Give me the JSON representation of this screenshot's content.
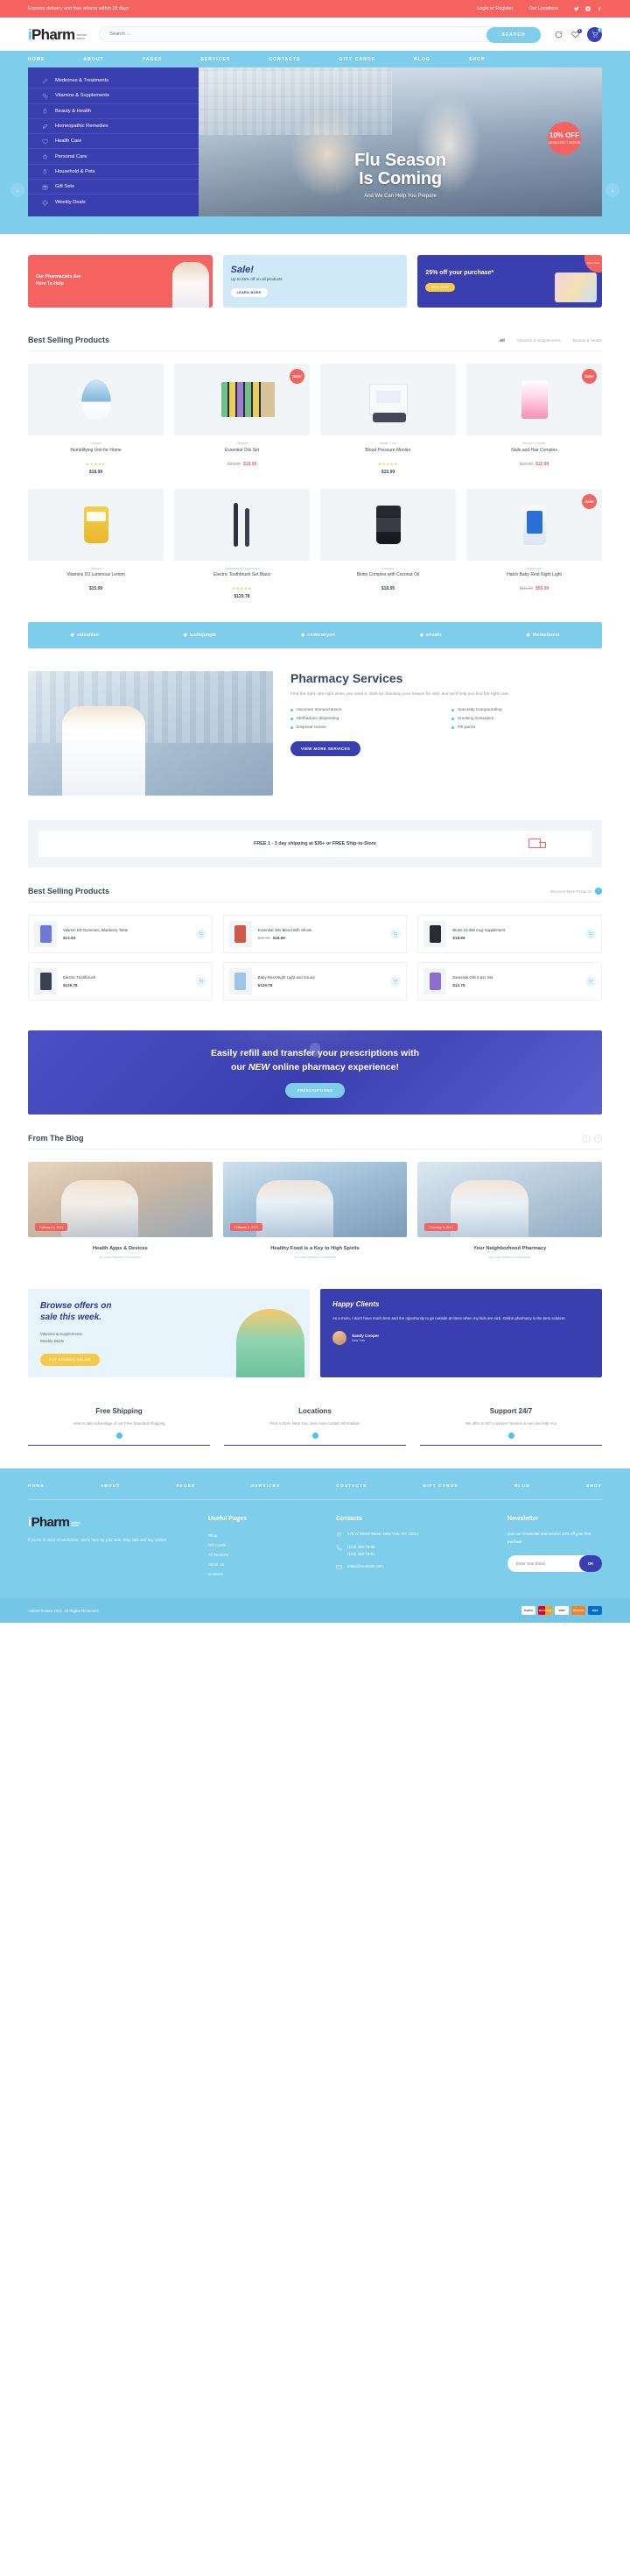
{
  "topbar": {
    "message": "Express delivery and free returns within 28 days",
    "login": "Login or",
    "register": "Register",
    "locations": "Our Locations",
    "socials": [
      "twitter-icon",
      "instagram-icon",
      "facebook-icon"
    ]
  },
  "header": {
    "logo_main": "Pharm",
    "logo_i": "i",
    "logo_sub_line1": "online",
    "logo_sub_line2": "store",
    "search_placeholder": "Search ...",
    "search_button": "SEARCH",
    "wishlist_count": "1",
    "cart_count": "0"
  },
  "nav": {
    "items": [
      "HOME",
      "ABOUT",
      "PAGES",
      "SERVICES",
      "CONTACTS",
      "GIFT CARDS",
      "BLOG",
      "SHOP"
    ]
  },
  "hero": {
    "categories": [
      {
        "label": "Medicines & Treatments",
        "icon": "syringe-icon"
      },
      {
        "label": "Vitamins & Supplements",
        "icon": "pills-icon"
      },
      {
        "label": "Beauty & Health",
        "icon": "lotion-icon"
      },
      {
        "label": "Homeopathic Remedies",
        "icon": "leaf-icon"
      },
      {
        "label": "Health Care",
        "icon": "heart-icon"
      },
      {
        "label": "Personal Care",
        "icon": "soap-icon"
      },
      {
        "label": "Household & Pets",
        "icon": "spray-icon"
      },
      {
        "label": "Gift Sets",
        "icon": "gift-icon"
      },
      {
        "label": "Weekly Deals",
        "icon": "cross-icon"
      }
    ],
    "title_line1": "Flu Season",
    "title_line2": "Is Coming",
    "subtitle": "And We Can Help You Prepare",
    "badge_big": "10% OFF",
    "badge_small": "WARM CARE 7 SEASON"
  },
  "promos": [
    {
      "text": "Our Pharmacists Are Here To Help",
      "style": "red",
      "icon": "medical-cross-icon"
    },
    {
      "title": "Sale!",
      "text": "Up to 25% off on all products",
      "button": "LEARN MORE",
      "style": "light-blue"
    },
    {
      "title": "25% off your purchase*",
      "button": "BUY NOW",
      "corner": "Shop Now",
      "style": "dark-blue"
    }
  ],
  "best_selling": {
    "title": "Best Selling Products",
    "tabs": [
      "All",
      "Vitamins & Supplements",
      "Beauty & Health"
    ],
    "active_tab": "All",
    "products": [
      {
        "category": "Lifestyle",
        "name": "Humidifying Unit for Home",
        "price": "$18.99",
        "old_price": "",
        "sale": false,
        "rating": 5,
        "shape": "sh-humidifier"
      },
      {
        "category": "Lifestyle",
        "name": "Essential Oils Set",
        "price": "$18.99",
        "old_price": "$32.99",
        "sale": true,
        "rating": 0,
        "shape": "sh-oils"
      },
      {
        "category": "Health Care",
        "name": "Blood Pressure Monitor",
        "price": "$15.99",
        "old_price": "",
        "sale": false,
        "rating": 5,
        "shape": "sh-bp"
      },
      {
        "category": "Beauty & Health",
        "name": "Nails and Hair Complex",
        "price": "$12.99",
        "old_price": "$19.99",
        "sale": true,
        "rating": 0,
        "shape": "sh-nail"
      },
      {
        "category": "Vitamins",
        "name": "Vitamins D3 Luminous Lemon",
        "price": "$15.99",
        "old_price": "",
        "sale": false,
        "rating": 0,
        "shape": "sh-gummy"
      },
      {
        "category": "Medicines & Treatments",
        "name": "Electric Toothbrush Set Black",
        "price": "$129.78",
        "old_price": "",
        "sale": false,
        "rating": 5,
        "shape": "sh-brush"
      },
      {
        "category": "Vitamins",
        "name": "Biotin Complex with Coconut Oil",
        "price": "$18.95",
        "old_price": "",
        "sale": false,
        "rating": 0,
        "shape": "sh-biotin"
      },
      {
        "category": "Night Light",
        "name": "Hatch Baby Rest Night Light",
        "price": "$59.99",
        "old_price": "$65.99",
        "sale": true,
        "rating": 0,
        "shape": "sh-nightlight"
      }
    ]
  },
  "brands": [
    {
      "name": "videohive",
      "icon": "video-icon"
    },
    {
      "name": "audiojungle",
      "icon": "audio-icon"
    },
    {
      "name": "codecanyon",
      "icon": "code-icon"
    },
    {
      "name": "envato",
      "icon": "envato-icon"
    },
    {
      "name": "themeforest",
      "icon": "theme-icon"
    }
  ],
  "services": {
    "title": "Pharmacy Services",
    "description": "Find the right care right when you need it. Start by choosing your reason for visit, and we'll help you find the right care.",
    "items": [
      "Vaccines Immunizations",
      "Specialty Compounding",
      "Methadone dispensing",
      "Smoking Cessation",
      "Disposal review",
      "Pill packs"
    ],
    "button": "VIEW MORE SERVICES"
  },
  "shipping": {
    "text": "FREE 1 - 3 day shipping at $35+ or FREE Ship-to-Store",
    "icon": "truck-icon"
  },
  "best_selling_list": {
    "title": "Best Selling Products",
    "discover": "Discover More Products",
    "items": [
      {
        "name": "Vitamin D3 Gummies, Blueberry Taste",
        "price": "$13.93",
        "old_price": "",
        "shape_color": "#6f77d8"
      },
      {
        "name": "Essential Oils Blend with Shook",
        "price": "$18.99",
        "old_price": "$32.99",
        "shape_color": "#cf5a4a"
      },
      {
        "name": "Biotin 10,000 mcg Supplement",
        "price": "$18.99",
        "old_price": "",
        "shape_color": "#2a2a33"
      },
      {
        "name": "Electric Toothbrush",
        "price": "$129.78",
        "old_price": "",
        "shape_color": "#3b4050"
      },
      {
        "name": "Baby Rest Night Light and Sound",
        "price": "$129.78",
        "old_price": "",
        "shape_color": "#9fc4e8"
      },
      {
        "name": "Essential Oils 5 psc Set",
        "price": "$12.78",
        "old_price": "",
        "shape_color": "#8a6fd0"
      }
    ]
  },
  "cta": {
    "line1": "Easily refill and transfer your prescriptions with",
    "line2_pre": "our",
    "line2_em": "NEW",
    "line2_post": "online pharmacy experience!",
    "button": "PRESCRIPTIONS"
  },
  "blog": {
    "title": "From The Blog",
    "posts": [
      {
        "date": "February 3, 2019",
        "title": "Health Apps & Devices",
        "meta": "by Linda Shares  0 Comments"
      },
      {
        "date": "February 3, 2019",
        "title": "Healthy Food is a Key to High Spirits",
        "meta": "by Linda Shares  0 Comments"
      },
      {
        "date": "February 3, 2019",
        "title": "Your Neighborhood Pharmacy",
        "meta": "by Linda Shares  0 Comments"
      }
    ]
  },
  "offers": {
    "title_line1": "Browse offers on",
    "title_line2": "sale this week.",
    "links": [
      "Vitamins & Supplements",
      "Weekly Deals"
    ],
    "button": "BUY STORIES ONLINE"
  },
  "testimonial": {
    "title": "Happy Clients",
    "quote": "As a mom, I don't have much time and the opportunity to go outside at times when my kids are sick. Online pharmacy is the best solution.",
    "name": "Sandy Cooper",
    "city": "New York"
  },
  "features": [
    {
      "title": "Free Shipping",
      "desc": "How to take advantage of our Free Standard Shipping"
    },
    {
      "title": "Locations",
      "desc": "Find a Store Near You, See more contact information"
    },
    {
      "title": "Support 24/7",
      "desc": "We offer a 24/7 customer Service so we can help You"
    }
  ],
  "footer": {
    "nav": [
      "HOME",
      "ABOUT",
      "PAGES",
      "SERVICES",
      "CONTACTS",
      "GIFT CARDS",
      "BLOG",
      "SHOP"
    ],
    "logo_main": "Pharm",
    "logo_i": "i",
    "logo_sub_line1": "online",
    "logo_sub_line2": "store",
    "about": "If you're in need of medicines - we're here by your side. Stay safe and buy online!",
    "useful_title": "Useful Pages",
    "useful_links": [
      "Shop",
      "Gift Cards",
      "All Services",
      "About Us",
      "Contacts"
    ],
    "contacts_title": "Contacts",
    "address": "176 W Street Name, New York, NY 10014",
    "phone1": "(123) 456-78-90",
    "phone2": "(123) 456-78-91",
    "email": "sales@example.com",
    "newsletter_title": "Newsletter",
    "newsletter_text": "Join our newsletter and receive 10% off your first puchase",
    "newsletter_placeholder": "Enter Your Email",
    "newsletter_button": "OK",
    "copyright": "AxiomThemes 2021. All Rights Reserved.",
    "payments": [
      "PayPal",
      "MasterCard",
      "VISA",
      "DISCOVER",
      "AMEX"
    ]
  }
}
